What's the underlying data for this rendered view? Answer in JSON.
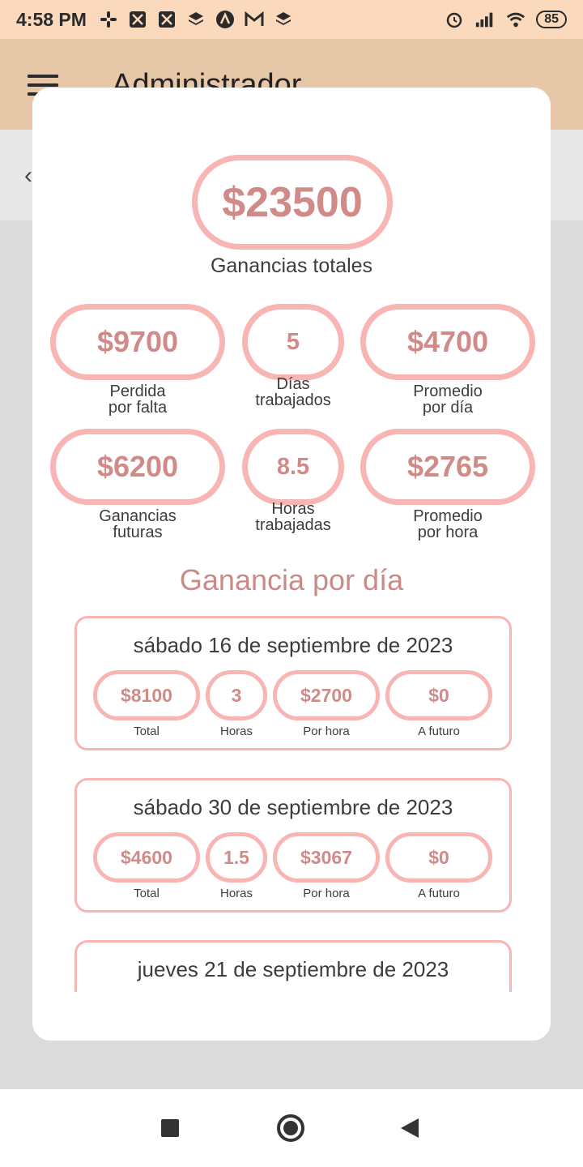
{
  "status_bar": {
    "time": "4:58 PM",
    "battery": "85"
  },
  "app_bar": {
    "title": "Administrador"
  },
  "summary": {
    "total_value": "$23500",
    "total_label": "Ganancias totales",
    "stats": [
      {
        "value": "$9700",
        "label": "Perdida\npor falta"
      },
      {
        "value": "5",
        "label": "Días\ntrabajados"
      },
      {
        "value": "$4700",
        "label": "Promedio\npor día"
      },
      {
        "value": "$6200",
        "label": "Ganancias\nfuturas"
      },
      {
        "value": "8.5",
        "label": "Horas\ntrabajadas"
      },
      {
        "value": "$2765",
        "label": "Promedio\npor hora"
      }
    ]
  },
  "section_title": "Ganancia por día",
  "columns": {
    "total": "Total",
    "hours": "Horas",
    "per_hour": "Por hora",
    "future": "A futuro"
  },
  "days": [
    {
      "title": "sábado 16 de septiembre de 2023",
      "total": "$8100",
      "hours": "3",
      "per_hour": "$2700",
      "future": "$0"
    },
    {
      "title": "sábado 30 de septiembre de 2023",
      "total": "$4600",
      "hours": "1.5",
      "per_hour": "$3067",
      "future": "$0"
    },
    {
      "title": "jueves 21 de septiembre de 2023"
    }
  ],
  "colors": {
    "accent_pink": "#f7b5b3",
    "value_text": "#d08a88",
    "status_bar": "#fbd9bd",
    "app_bar": "#e6c7a8"
  }
}
